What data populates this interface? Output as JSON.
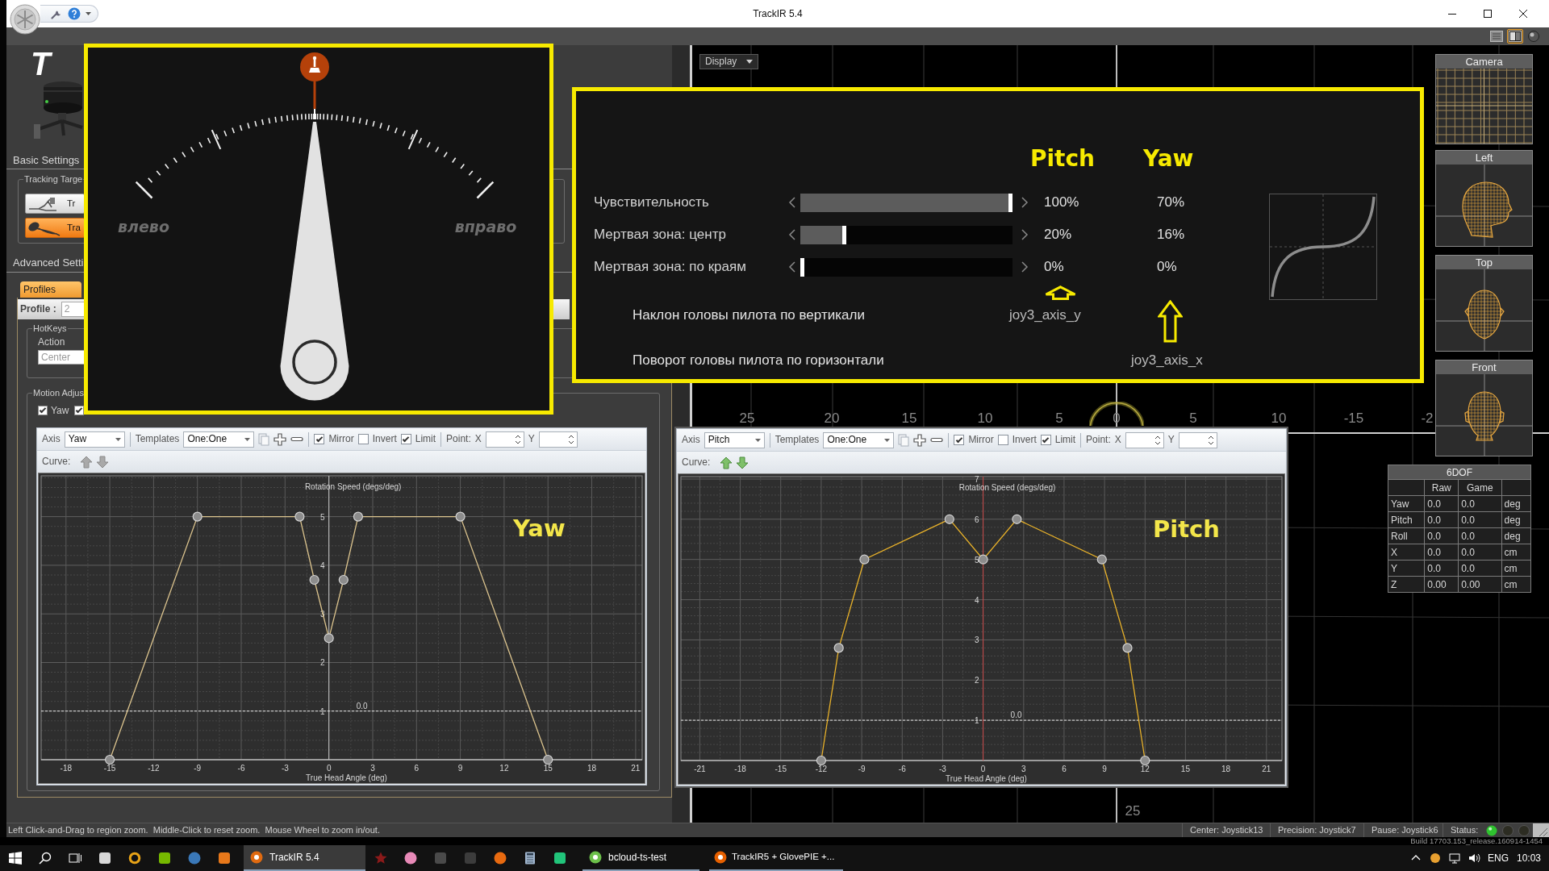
{
  "window": {
    "title": "TrackIR 5.4"
  },
  "view_modes": [
    {
      "kind": "list",
      "selected": false
    },
    {
      "kind": "split",
      "selected": true
    },
    {
      "kind": "sphere",
      "selected": false
    }
  ],
  "sidebar": {
    "logo": "T",
    "basic_settings": {
      "title": "Basic Settings",
      "tracking_target": {
        "title": "Tracking Targe",
        "buttons": [
          {
            "kind": "clip",
            "label": "Tr",
            "selected": false
          },
          {
            "kind": "cap",
            "label": "Tra",
            "selected": true
          }
        ]
      }
    },
    "advanced_settings": {
      "title": "Advanced Setti",
      "tabs": [
        {
          "label": "Profiles",
          "selected": true
        }
      ],
      "profile": {
        "label": "Profile :",
        "value": "2",
        "disabled": true
      },
      "hotkeys": {
        "title": "HotKeys",
        "action_label": "Action",
        "action": {
          "value": "Center",
          "disabled": true
        }
      },
      "motion_adjust": {
        "title": "Motion Adjus",
        "checkboxes": [
          {
            "label": "Yaw",
            "checked": true
          },
          {
            "checked": true
          }
        ]
      }
    }
  },
  "gauge_overlay": {
    "level": 0.5,
    "left_label": "влево",
    "right_label": "вправо"
  },
  "view": {
    "display_button": "Display",
    "ruler": [
      "25",
      "20",
      "15",
      "10",
      "5",
      "0",
      "5",
      "10",
      "-15",
      "-2"
    ],
    "bottom_label": "25"
  },
  "settings_overlay": {
    "columns": [
      "Pitch",
      "Yaw"
    ],
    "rows": [
      {
        "label": "Чувствительность",
        "level": 1,
        "pitch": "100%",
        "yaw": "70%"
      },
      {
        "label": "Мертвая зона: центр",
        "level": 0.2,
        "pitch": "20%",
        "yaw": "16%"
      },
      {
        "label": "Мертвая зона: по краям",
        "level": 0,
        "pitch": "0%",
        "yaw": "0%"
      }
    ],
    "axes": [
      {
        "label": "Наклон головы пилота по вертикали",
        "binding": "joy3_axis_y"
      },
      {
        "label": "Поворот головы пилота по горизонтали",
        "binding": "joy3_axis_x"
      }
    ]
  },
  "view_panels": [
    {
      "title": "Camera",
      "kind": "camera"
    },
    {
      "title": "Left",
      "kind": "side"
    },
    {
      "title": "Top",
      "kind": "top"
    },
    {
      "title": "Front",
      "kind": "front"
    }
  ],
  "dof_table": {
    "title": "6DOF",
    "columns": [
      "Raw",
      "Game"
    ],
    "rows": [
      {
        "axis": "Yaw",
        "raw": "0.0",
        "game": "0.0",
        "unit": "deg"
      },
      {
        "axis": "Pitch",
        "raw": "0.0",
        "game": "0.0",
        "unit": "deg"
      },
      {
        "axis": "Roll",
        "raw": "0.0",
        "game": "0.0",
        "unit": "deg"
      },
      {
        "axis": "X",
        "raw": "0.0",
        "game": "0.0",
        "unit": "cm"
      },
      {
        "axis": "Y",
        "raw": "0.0",
        "game": "0.0",
        "unit": "cm"
      },
      {
        "axis": "Z",
        "raw": "0.00",
        "game": "0.00",
        "unit": "cm"
      }
    ]
  },
  "axis_editors": [
    {
      "axis": {
        "label": "Axis",
        "value": "Yaw"
      },
      "template": {
        "label": "Templates",
        "value": "One:One"
      },
      "options": [
        {
          "label": "Mirror",
          "checked": true
        },
        {
          "label": "Invert",
          "checked": false
        },
        {
          "label": "Limit",
          "checked": true
        }
      ],
      "point": {
        "label": "Point:",
        "x_label": "X",
        "y_label": "Y"
      },
      "curve": {
        "label": "Curve:",
        "disabled": true
      },
      "caption": "Yaw",
      "chart_data": {
        "type": "line",
        "xlabel": "True Head Angle (deg)",
        "ylabel": "Rotation Speed (degs/deg)",
        "x": [
          -15,
          -9,
          -2,
          -1,
          0,
          1,
          2,
          9,
          15
        ],
        "series": [
          {
            "color": "#dcc48e",
            "marker": "circle",
            "values": [
              0,
              5,
              5,
              3.7,
              2.5,
              3.7,
              5,
              5,
              0
            ]
          }
        ],
        "xlim": [
          -19.7,
          21.45
        ],
        "ylim": [
          0,
          5.84
        ],
        "xticks": [
          -18,
          -15,
          -12,
          -9,
          -6,
          -3,
          0,
          3,
          6,
          9,
          12,
          15,
          18,
          21
        ],
        "yticks": [
          1,
          2,
          3,
          4,
          5
        ],
        "grid": true,
        "ref_lines": [
          {
            "axis": "y",
            "value": 1
          }
        ],
        "annotations": [
          "0.0"
        ]
      }
    },
    {
      "axis": {
        "label": "Axis",
        "value": "Pitch"
      },
      "template": {
        "label": "Templates",
        "value": "One:One"
      },
      "options": [
        {
          "label": "Mirror",
          "checked": true
        },
        {
          "label": "Invert",
          "checked": false
        },
        {
          "label": "Limit",
          "checked": true
        }
      ],
      "point": {
        "label": "Point:",
        "x_label": "X",
        "y_label": "Y"
      },
      "curve": {
        "label": "Curve:",
        "disabled": false
      },
      "caption": "Pitch",
      "chart_data": {
        "type": "line",
        "xlabel": "True Head Angle (deg)",
        "ylabel": "Rotation Speed (degs/deg)",
        "x": [
          -12,
          -10.7,
          -8.8,
          -2.5,
          0,
          2.5,
          8.8,
          10.7,
          12
        ],
        "series": [
          {
            "color": "#e9b22a",
            "marker": "circle",
            "values": [
              0,
              2.8,
              5,
              6,
              5,
              6,
              5,
              2.8,
              0
            ]
          }
        ],
        "xlim": [
          -22.4,
          22.15
        ],
        "ylim": [
          0,
          7.06
        ],
        "xticks": [
          -21,
          -18,
          -15,
          -12,
          -9,
          -6,
          -3,
          0,
          3,
          6,
          9,
          12,
          15,
          18,
          21
        ],
        "yticks": [
          1,
          2,
          3,
          4,
          5,
          6,
          7
        ],
        "grid": true,
        "ref_lines": [
          {
            "axis": "y",
            "value": 1
          }
        ],
        "annotations": [
          "0.0"
        ]
      }
    }
  ],
  "status_bar": {
    "hint": "Left Click-and-Drag to region zoom.  Middle-Click to reset zoom.  Mouse Wheel to zoom in/out.",
    "fields": [
      "Center: Joystick13",
      "Precision: Joystick7",
      "Pause: Joystick6"
    ],
    "status_label": "Status:",
    "leds": [
      {
        "on": true
      },
      {
        "on": false
      },
      {
        "on": false
      }
    ],
    "build": "Build 17703.153_release.160914-1454"
  },
  "taskbar": {
    "items": [
      {
        "kind": "start"
      },
      {
        "kind": "search"
      },
      {
        "kind": "task_view"
      },
      {
        "kind": "tile",
        "color": "#d8d8d8"
      },
      {
        "kind": "ring",
        "color": "#e8a317"
      },
      {
        "kind": "tile",
        "color": "#76b900"
      },
      {
        "kind": "circle",
        "color": "#3a78b8"
      },
      {
        "kind": "tile",
        "color": "#e8781a"
      },
      {
        "kind": "window",
        "label": "TrackIR 5.4",
        "color": "#e06a10",
        "selected": true
      },
      {
        "kind": "star",
        "color": "#8b1a1a"
      },
      {
        "kind": "circle",
        "color": "#e88ab8"
      },
      {
        "kind": "tile",
        "color": "#4a4a4a"
      },
      {
        "kind": "tile",
        "color": "#3c3c3c"
      },
      {
        "kind": "circle",
        "color": "#e86a10"
      },
      {
        "kind": "calculator",
        "color": "#9fb4cc"
      },
      {
        "kind": "tile",
        "color": "#21c47a"
      },
      {
        "kind": "window",
        "label": "bcloud-ts-test",
        "color": "#6cc04a",
        "selected": false
      },
      {
        "kind": "window",
        "label": "TrackIR5 + GlovePIE +...",
        "color": "#e66000",
        "selected": false
      }
    ],
    "tray": {
      "items": [
        {
          "kind": "chevron"
        },
        {
          "kind": "app"
        },
        {
          "kind": "network"
        },
        {
          "kind": "volume"
        }
      ],
      "language": "ENG",
      "time": "10:03"
    }
  }
}
